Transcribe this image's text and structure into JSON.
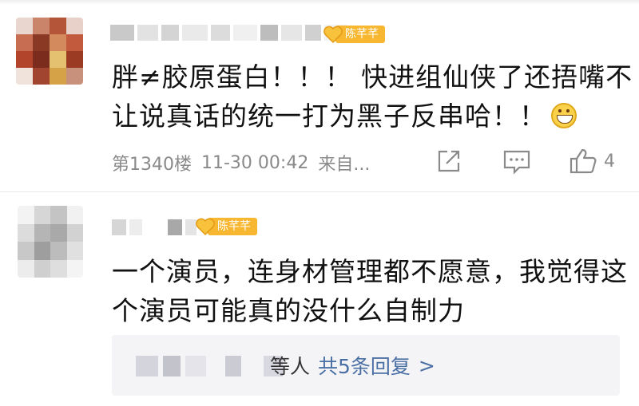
{
  "comments": [
    {
      "fan_badge": "陈芊芊",
      "text_lines": [
        "胖≠胶原蛋白！！！ 快进组仙侠了还捂嘴不",
        "让说真话的统一打为黑子反串哈！！"
      ],
      "emoji": "grin-emoji",
      "meta": {
        "floor": "第1340楼",
        "time": "11-30 00:42",
        "source": "来自..."
      },
      "like_count": "4"
    },
    {
      "fan_badge": "陈芊芊",
      "text_lines": [
        "一个演员，连身材管理都不愿意，我觉得这",
        "个演员可能真的没什么自制力"
      ],
      "replies": {
        "suffix": "等人",
        "link_label": "共5条回复",
        "arrow": ">"
      }
    }
  ],
  "colors": {
    "badge": "#f7b731",
    "meta_text": "#8a8a8a",
    "link": "#4a6fa5",
    "reply_bg": "#f4f4f6"
  }
}
